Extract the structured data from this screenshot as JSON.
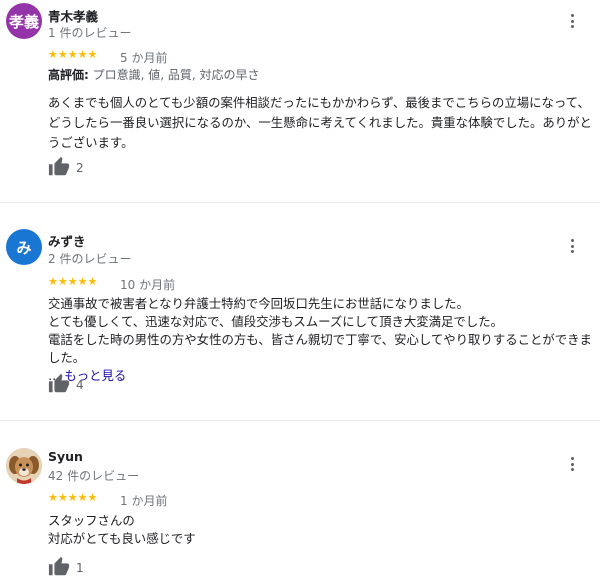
{
  "reviews": [
    {
      "avatar_text": "孝義",
      "avatar_color": "#9334a8",
      "name": "青木孝義",
      "review_count": "1 件のレビュー",
      "stars": "★★★★★",
      "age": "5 か月前",
      "highlight_label": "高評価:",
      "highlight_values": "プロ意識, 値, 品質, 対応の早さ",
      "text": "あくまでも個人のとても少額の案件相談だったにもかかわらず、最後までこちらの立場になって、どうしたら一番良い選択になるのか、一生懸命に考えてくれました。貴重な体験でした。ありがとうございます。",
      "likes": "2"
    },
    {
      "avatar_text": "み",
      "avatar_color": "#1976d2",
      "name": "みずき",
      "review_count": "2 件のレビュー",
      "stars": "★★★★★",
      "age": "10 か月前",
      "text_lines": [
        "交通事故で被害者となり弁護士特約で今回坂口先生にお世話になりました。",
        "とても優しくて、迅速な対応で、値段交渉もスムーズにして頂き大変満足でした。",
        "電話をした時の男性の方や女性の方も、皆さん親切で丁寧で、安心してやり取りすることができました。"
      ],
      "more_prefix": "…",
      "more_label": "もっと見る",
      "likes": "4"
    },
    {
      "name": "Syun",
      "review_count": "42 件のレビュー",
      "stars": "★★★★★",
      "age": "1 か月前",
      "text_lines": [
        "スタッフさんの",
        "対応がとても良い感じです"
      ],
      "likes": "1"
    }
  ]
}
